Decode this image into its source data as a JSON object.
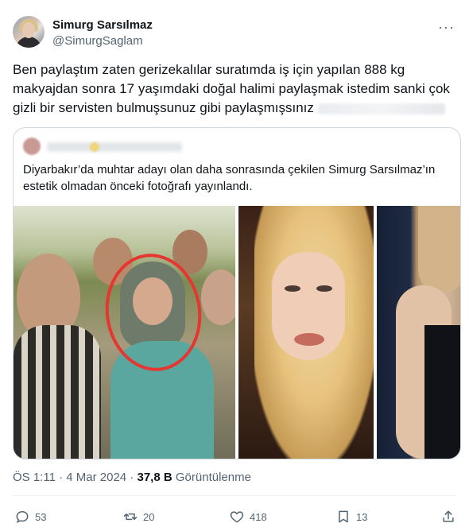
{
  "author": {
    "name": "Simurg Sarsılmaz",
    "handle": "@SimurgSaglam"
  },
  "more_label": "···",
  "tweet": {
    "text": "Ben paylaştım zaten gerizekalılar suratımda iş için yapılan 888 kg makyajdan sonra 17 yaşımdaki doğal halimi paylaşmak istedim sanki çok gizli bir servisten bulmuşsunuz gibi paylaşmışsınız"
  },
  "quoted": {
    "text": "Diyarbakır’da muhtar adayı olan daha sonrasında çekilen Simurg Sarsılmaz’ın estetik olmadan önceki fotoğrafı yayınlandı."
  },
  "meta": {
    "time": "ÖS 1:11",
    "separator": "·",
    "date": "4 Mar 2024",
    "views": "37,8 B",
    "views_label": "Görüntülenme"
  },
  "actions": {
    "reply_count": "53",
    "retweet_count": "20",
    "like_count": "418",
    "bookmark_count": "13"
  },
  "colors": {
    "text": "#0f1419",
    "muted": "#536471",
    "border": "#cfd9de",
    "circle": "#e5362f"
  }
}
